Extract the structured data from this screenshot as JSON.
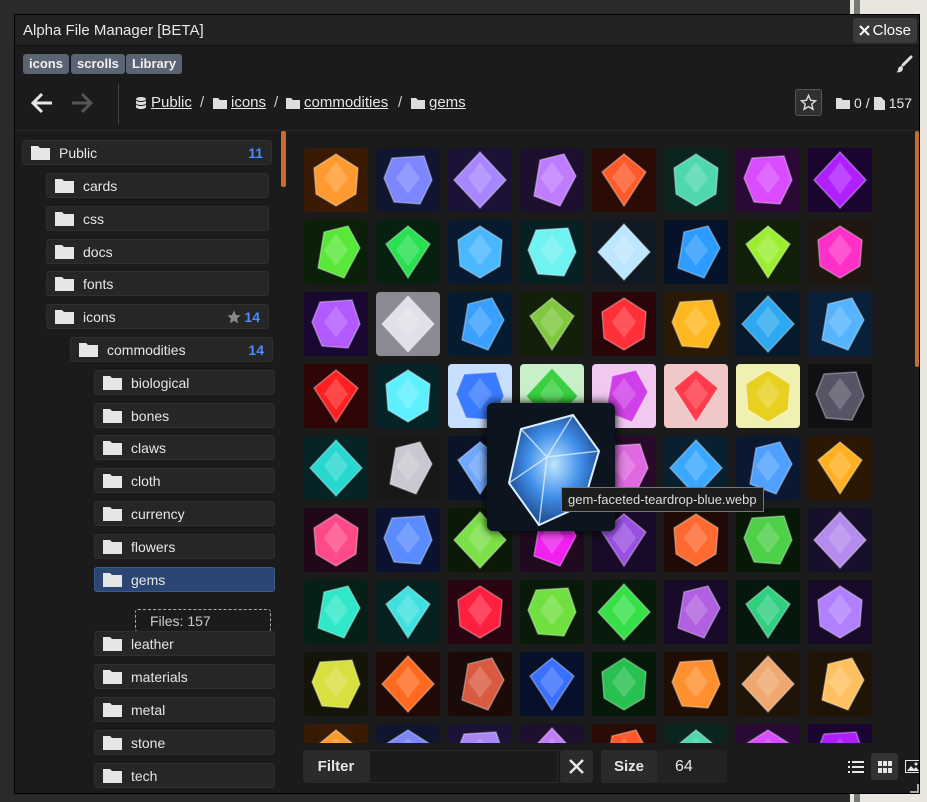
{
  "window": {
    "title": "Alpha File Manager [BETA]",
    "close_label": "Close"
  },
  "tags": [
    "icons",
    "scrolls",
    "Library"
  ],
  "breadcrumb": [
    {
      "label": "Public",
      "icon": "database-icon"
    },
    {
      "label": "icons",
      "icon": "folder-icon"
    },
    {
      "label": "commodities",
      "icon": "folder-icon"
    },
    {
      "label": "gems",
      "icon": "folder-icon"
    }
  ],
  "counts": {
    "folders": "0",
    "files": "157"
  },
  "tree": {
    "public": {
      "label": "Public",
      "count": "11"
    },
    "cards": "cards",
    "css": "css",
    "docs": "docs",
    "fonts": "fonts",
    "icons": {
      "label": "icons",
      "count": "14"
    },
    "commodities": {
      "label": "commodities",
      "count": "14"
    },
    "biological": "biological",
    "bones": "bones",
    "claws": "claws",
    "cloth": "cloth",
    "currency": "currency",
    "flowers": "flowers",
    "gems": "gems",
    "files_label": "Files: 157",
    "leather": "leather",
    "materials": "materials",
    "metal": "metal",
    "stone": "stone",
    "tech": "tech"
  },
  "tooltip": "gem-faceted-teardrop-blue.webp",
  "bottom": {
    "filter_label": "Filter",
    "filter_value": "",
    "size_label": "Size",
    "size_value": "64"
  },
  "colors": {
    "accent_blue": "#4a8cff",
    "selected_bg": "#2b4672",
    "scroll_orange": "#c76a36",
    "tag_bg": "#5a6472"
  }
}
